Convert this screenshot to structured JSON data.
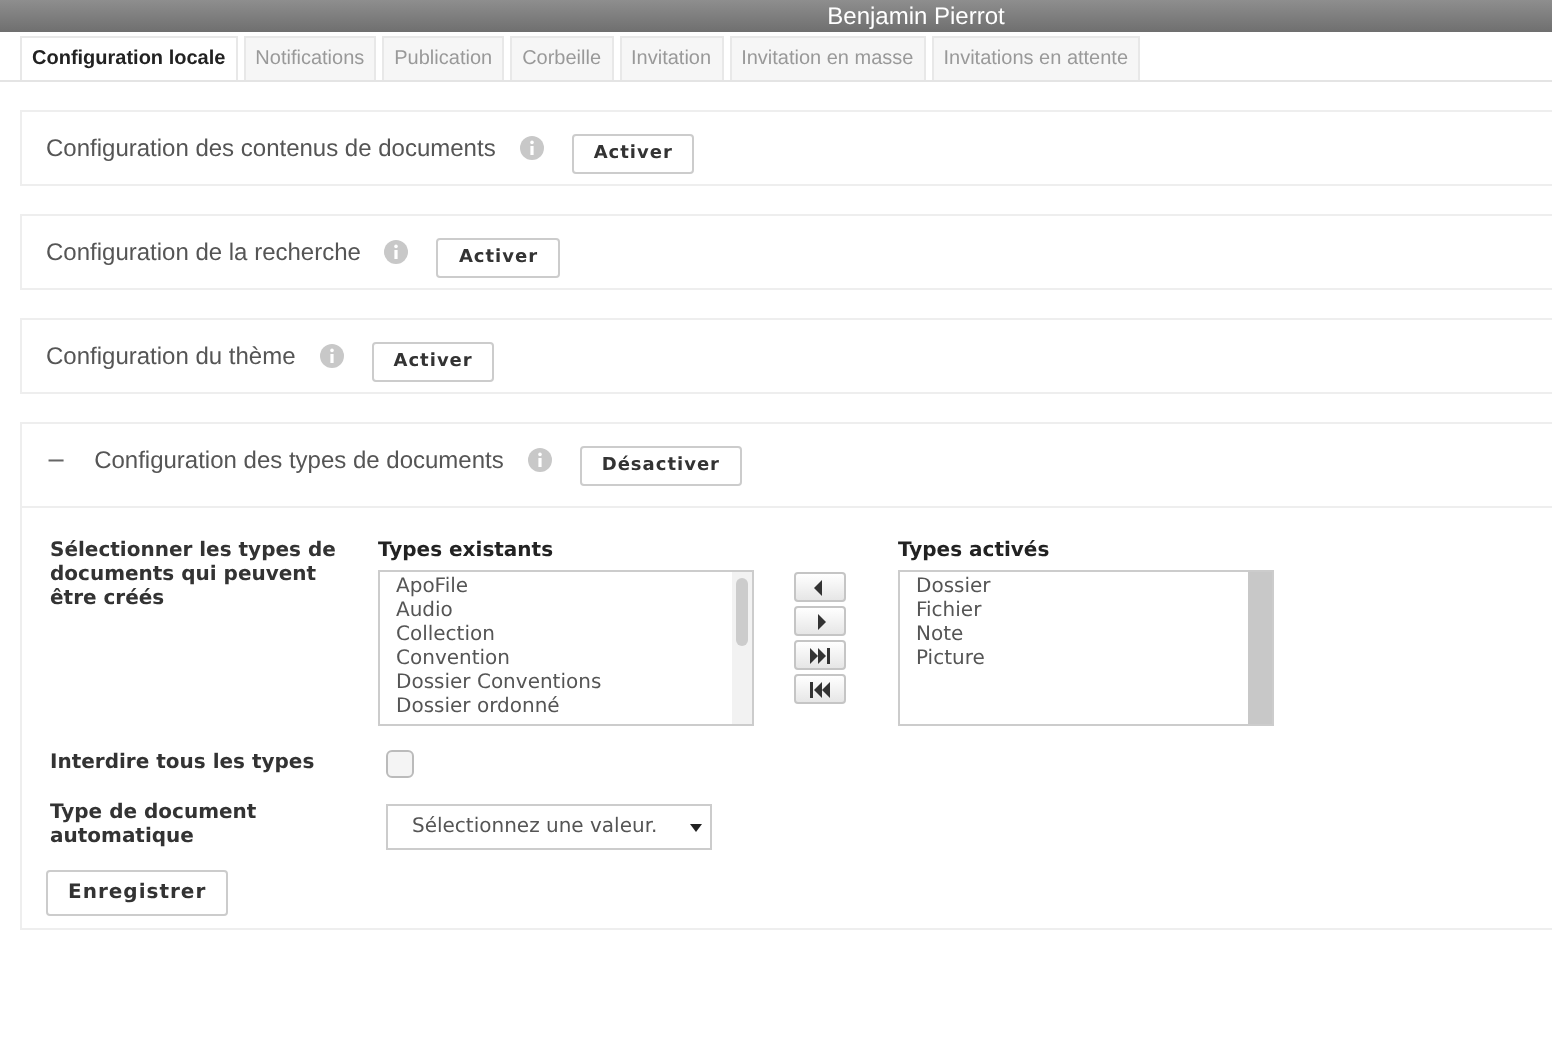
{
  "header": {
    "user_name": "Benjamin Pierrot"
  },
  "tabs": [
    {
      "label": "Configuration locale",
      "selected": true
    },
    {
      "label": "Notifications",
      "selected": false
    },
    {
      "label": "Publication",
      "selected": false
    },
    {
      "label": "Corbeille",
      "selected": false
    },
    {
      "label": "Invitation",
      "selected": false
    },
    {
      "label": "Invitation en masse",
      "selected": false
    },
    {
      "label": "Invitations en attente",
      "selected": false
    }
  ],
  "sections": [
    {
      "title": "Configuration des contenus de documents",
      "button": "Activer",
      "expanded": false
    },
    {
      "title": "Configuration de la recherche",
      "button": "Activer",
      "expanded": false
    },
    {
      "title": "Configuration du thème",
      "button": "Activer",
      "expanded": false
    },
    {
      "title": "Configuration des types de documents",
      "button": "Désactiver",
      "expanded": true,
      "toggle": "−"
    }
  ],
  "types_form": {
    "select_label": "Sélectionner les types de documents qui peuvent être créés",
    "existing": {
      "heading": "Types existants",
      "items": [
        "ApoFile",
        "Audio",
        "Collection",
        "Convention",
        "Dossier Conventions",
        "Dossier ordonné"
      ]
    },
    "enabled": {
      "heading": "Types activés",
      "items": [
        "Dossier",
        "Fichier",
        "Note",
        "Picture"
      ]
    },
    "forbid_all": {
      "label": "Interdire tous les types",
      "checked": false
    },
    "auto_type": {
      "label": "Type de document automatique",
      "value": "Sélectionnez une valeur."
    },
    "save_button": "Enregistrer"
  }
}
